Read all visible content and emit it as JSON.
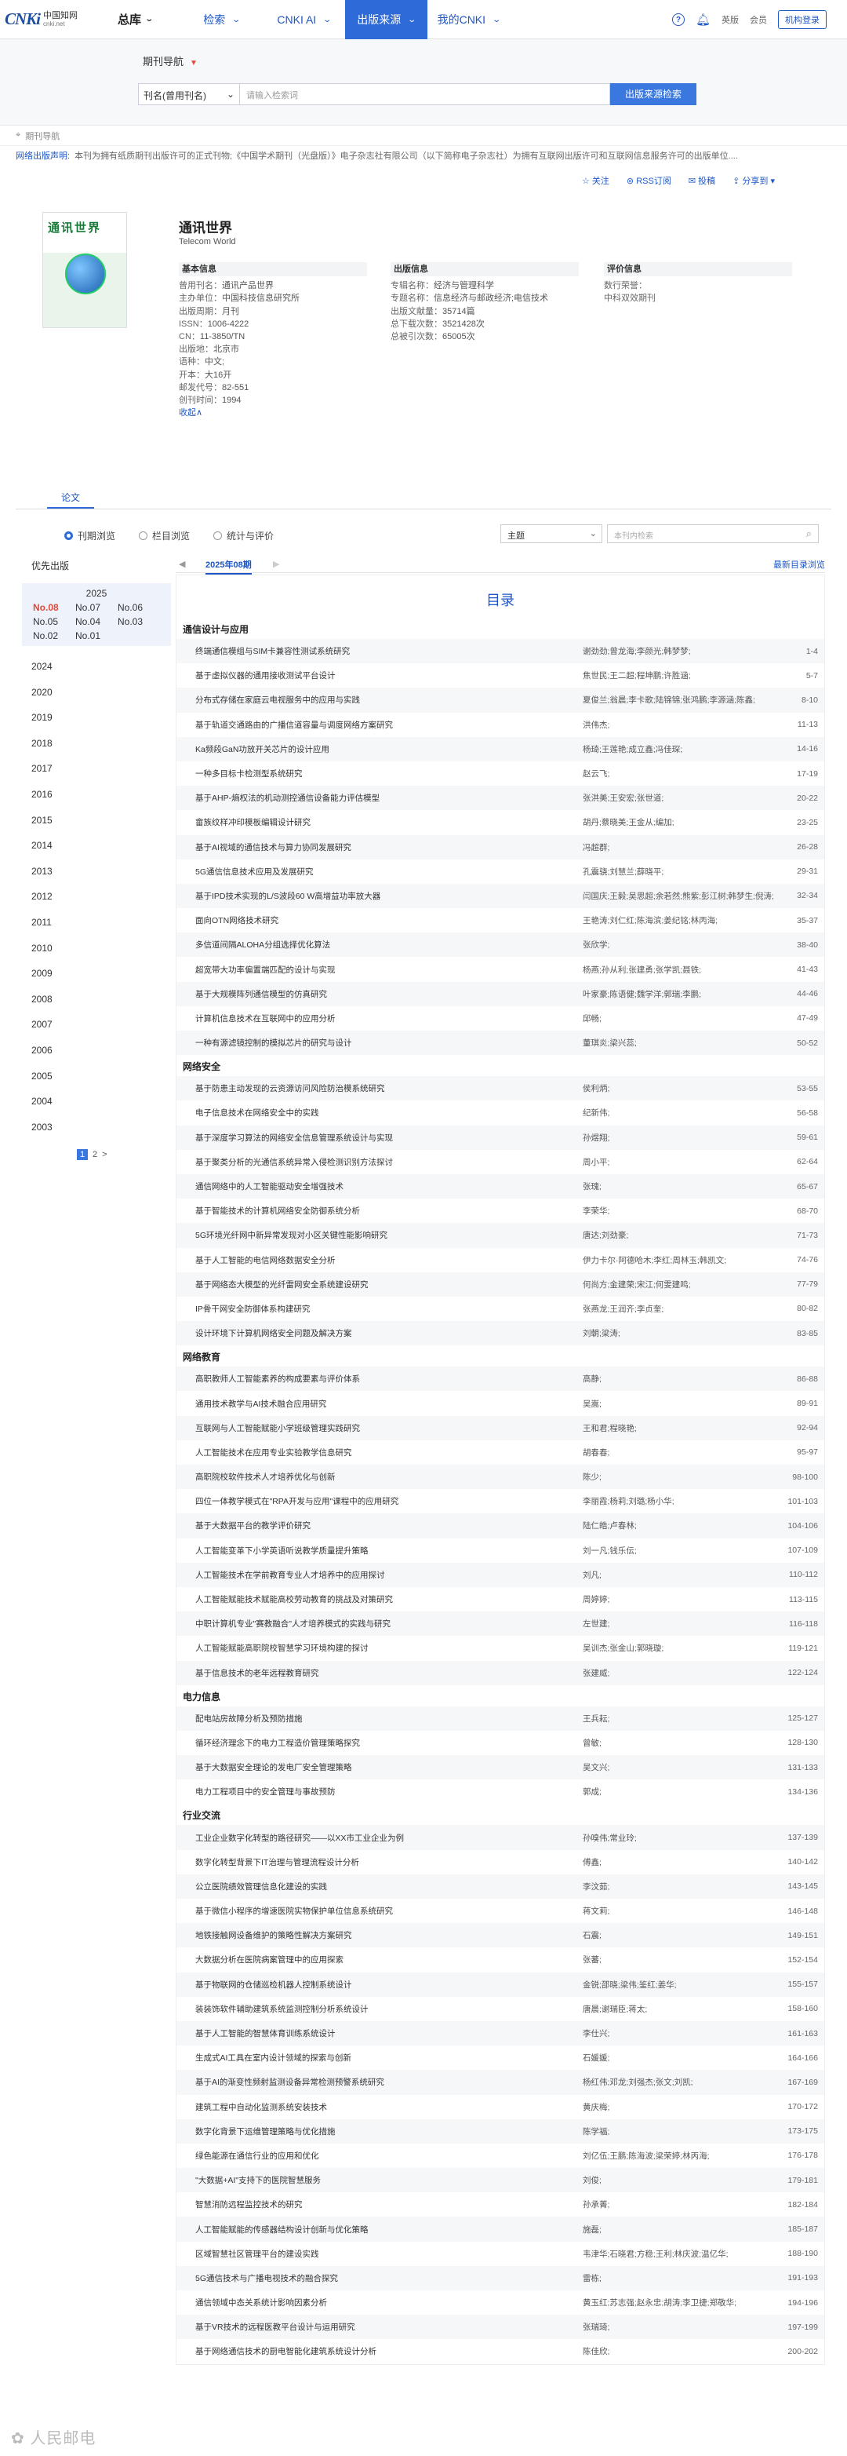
{
  "header": {
    "logo_mark": "CNKi",
    "logo_cn": "中国知网",
    "logo_sub": "cnki.net",
    "zongku": "总库",
    "nav": [
      {
        "label": "检索",
        "active": false
      },
      {
        "label": "CNKI AI",
        "active": false
      },
      {
        "label": "出版来源",
        "active": true
      },
      {
        "label": "我的CNKI",
        "active": false
      }
    ],
    "help": "?",
    "links": [
      "英版",
      "会员"
    ],
    "login": "机构登录"
  },
  "search": {
    "title": "期刊导航",
    "field": "刊名(曾用刊名)",
    "placeholder": "请输入检索词",
    "button": "出版来源检索"
  },
  "breadcrumb": "期刊导航",
  "notice": {
    "label": "网络出版声明:",
    "text": "本刊为拥有纸质期刊出版许可的正式刊物;《中国学术期刊（光盘版）》电子杂志社有限公司（以下简称电子杂志社）为拥有互联网出版许可和互联网信息服务许可的出版单位...."
  },
  "actions": [
    "关注",
    "RSS订阅",
    "投稿",
    "分享到"
  ],
  "journal": {
    "cover_title": "通讯世界",
    "name": "通讯世界",
    "en_name": "Telecom World",
    "basic_title": "基本信息",
    "basic": [
      [
        "曾用刊名：",
        "通讯产品世界"
      ],
      [
        "主办单位：",
        "中国科技信息研究所"
      ],
      [
        "出版周期：",
        "月刊"
      ],
      [
        "ISSN：",
        "1006-4222"
      ],
      [
        "CN：",
        "11-3850/TN"
      ],
      [
        "出版地：",
        "北京市"
      ],
      [
        "语种：",
        "中文;"
      ],
      [
        "开本：",
        "大16开"
      ],
      [
        "邮发代号：",
        "82-551"
      ],
      [
        "创刊时间：",
        "1994"
      ]
    ],
    "more": "收起∧",
    "pub_title": "出版信息",
    "pub": [
      [
        "专辑名称：",
        "经济与管理科学"
      ],
      [
        "专题名称：",
        "信息经济与邮政经济;电信技术"
      ],
      [
        "出版文献量：",
        "35714篇"
      ],
      [
        "总下载次数：",
        "3521428次"
      ],
      [
        "总被引次数：",
        "65005次"
      ]
    ],
    "eval_title": "评价信息",
    "eval": [
      [
        "数行荣誉：",
        ""
      ],
      [
        "中科双效期刊",
        ""
      ]
    ]
  },
  "tabs": [
    "论文"
  ],
  "radios": [
    {
      "label": "刊期浏览",
      "on": true
    },
    {
      "label": "栏目浏览",
      "on": false
    },
    {
      "label": "统计与评价",
      "on": false
    }
  ],
  "filter": {
    "subject": "主题",
    "search_placeholder": "本刊内检索"
  },
  "left": {
    "first": "优先出版",
    "cur_year": "2025",
    "issues": [
      "No.08",
      "No.07",
      "No.06",
      "No.05",
      "No.04",
      "No.03",
      "No.02",
      "No.01"
    ],
    "years": [
      "2024",
      "2020",
      "2019",
      "2018",
      "2017",
      "2016",
      "2015",
      "2014",
      "2013",
      "2012",
      "2011",
      "2010",
      "2009",
      "2008",
      "2007",
      "2006",
      "2005",
      "2004",
      "2003"
    ],
    "pages": [
      "1",
      "2",
      ">"
    ]
  },
  "issuebar": {
    "prev": "◀",
    "cur": "2025年08期",
    "next": "▶",
    "toclink": "最新目录浏览"
  },
  "toc": {
    "title": "目录",
    "sections": [
      {
        "name": "通信设计与应用",
        "items": [
          [
            "终端通信模组与SIM卡兼容性测试系统研究",
            "谢劲劲;曾龙海;李颜光;韩梦梦;",
            "1-4"
          ],
          [
            "基于虚拟仪器的通用接收测试平台设计",
            "焦世民;王二超;程坤鹏;许胜涵;",
            "5-7"
          ],
          [
            "分布式存储在家庭云电视服务中的应用与实践",
            "夏俊兰;翁晨;李卡歌;陆锦锦;张鸿鹏;李源涵;陈鑫;",
            "8-10"
          ],
          [
            "基于轨道交通路由的广播信道容量与调度网络方案研究",
            "洪伟杰;",
            "11-13"
          ],
          [
            "Ka频段GaN功放开关芯片的设计应用",
            "杨琦;王莲艳;成立鑫;冯佳琛;",
            "14-16"
          ],
          [
            "一种多目标卡检测型系统研究",
            "赵云飞;",
            "17-19"
          ],
          [
            "基于AHP-熵权法的机动测控通信设备能力评估模型",
            "张洪美;王安宏;张世道;",
            "20-22"
          ],
          [
            "畲族纹样冲印模板编辑设计研究",
            "胡丹;蔡晓美;王金从;编加;",
            "23-25"
          ],
          [
            "基于AI视域的通信技术与算力协同发展研究",
            "冯超群;",
            "26-28"
          ],
          [
            "5G通信信息技术应用及发展研究",
            "孔震骁;刘慧兰;薛晓平;",
            "29-31"
          ],
          [
            "基于IPD技术实现的L/S波段60 W高增益功率放大器",
            "闫国庆;王毅;吴思超;余若然;熊紫;彭江树;韩梦生;倪涛;",
            "32-34"
          ],
          [
            "面向OTN网络技术研究",
            "王艳涛;刘仁红;陈海滨;姜纪铭;林丙海;",
            "35-37"
          ],
          [
            "多信道间隔ALOHA分组选择优化算法",
            "张欣学;",
            "38-40"
          ],
          [
            "超宽带大功率偏置端匹配的设计与实现",
            "杨燕;孙从利;张建勇;张学凯;聂铁;",
            "41-43"
          ],
          [
            "基于大规模阵列通信模型的仿真研究",
            "叶家豪;陈语健;魏学洋;郭瑞;李鹏;",
            "44-46"
          ],
          [
            "计算机信息技术在互联网中的应用分析",
            "邱畅;",
            "47-49"
          ],
          [
            "一种有源滤镜控制的模拟芯片的研究与设计",
            "董琪炎;梁兴蕊;",
            "50-52"
          ]
        ]
      },
      {
        "name": "网络安全",
        "items": [
          [
            "基于防患主动发现的云资源访问风险防治模系统研究",
            "侯利炳;",
            "53-55"
          ],
          [
            "电子信息技术在网络安全中的实践",
            "纪新伟;",
            "56-58"
          ],
          [
            "基于深度学习算法的网络安全信息管理系统设计与实现",
            "孙煜翔;",
            "59-61"
          ],
          [
            "基于聚类分析的光通信系统异常入侵检测识别方法探讨",
            "周小平;",
            "62-64"
          ],
          [
            "通信网络中的人工智能驱动安全增强技术",
            "张瑰;",
            "65-67"
          ],
          [
            "基于智能技术的计算机网络安全防御系统分析",
            "李荣华;",
            "68-70"
          ],
          [
            "5G环境光纤网中新异常发现对小区关键性能影响研究",
            "唐达;刘劲豪;",
            "71-73"
          ],
          [
            "基于人工智能的电信网络数据安全分析",
            "伊力卡尔·阿德哈木;李红;周林玉;韩凯文;",
            "74-76"
          ],
          [
            "基于网络态大模型的光纤雷网安全系统建设研究",
            "何尚方;金建荣;宋江;何雯建鸣;",
            "77-79"
          ],
          [
            "IP骨干网安全防御体系构建研究",
            "张燕龙;王润齐;李贞奎;",
            "80-82"
          ],
          [
            "设计环境下计算机网络安全问题及解决方案",
            "刘朝;梁涛;",
            "83-85"
          ]
        ]
      },
      {
        "name": "网络教育",
        "items": [
          [
            "高职教师人工智能素养的构成要素与评价体系",
            "高静;",
            "86-88"
          ],
          [
            "通用技术教学与AI技术融合应用研究",
            "吴嵩;",
            "89-91"
          ],
          [
            "互联网与人工智能赋能小学班级管理实践研究",
            "王和君;程晓艳;",
            "92-94"
          ],
          [
            "人工智能技术在应用专业实验教学信息研究",
            "胡春春;",
            "95-97"
          ],
          [
            "高职院校软件技术人才培养优化与创新",
            "陈少;",
            "98-100"
          ],
          [
            "四位一体教学模式在\"RPA开发与应用\"课程中的应用研究",
            "李丽霞;杨莉;刘璐;杨小华;",
            "101-103"
          ],
          [
            "基于大数据平台的教学评价研究",
            "陆仁皓;卢春林;",
            "104-106"
          ],
          [
            "人工智能变革下小学英语听说教学质量提升策略",
            "刘一凡;钱乐伝;",
            "107-109"
          ],
          [
            "人工智能技术在学前教育专业人才培养中的应用探讨",
            "刘凡;",
            "110-112"
          ],
          [
            "人工智能赋能技术赋能高校劳动教育的挑战及对策研究",
            "周婷婷;",
            "113-115"
          ],
          [
            "中职计算机专业\"赛教融合\"人才培养模式的实践与研究",
            "左世建;",
            "116-118"
          ],
          [
            "人工智能赋能高职院校智慧学习环境构建的探讨",
            "吴训杰;张金山;郭晓璇;",
            "119-121"
          ],
          [
            "基于信息技术的老年远程教育研究",
            "张建威;",
            "122-124"
          ]
        ]
      },
      {
        "name": "电力信息",
        "items": [
          [
            "配电站房故障分析及预防措施",
            "王兵耘;",
            "125-127"
          ],
          [
            "循环经济理念下的电力工程造价管理策略探究",
            "曾敏;",
            "128-130"
          ],
          [
            "基于大数据安全理论的发电厂安全管理策略",
            "吴文兴;",
            "131-133"
          ],
          [
            "电力工程项目中的安全管理与事故预防",
            "郭成;",
            "134-136"
          ]
        ]
      },
      {
        "name": "行业交流",
        "items": [
          [
            "工业企业数字化转型的路径研究——以XX市工业企业为例",
            "孙嗅伟;常业玲;",
            "137-139"
          ],
          [
            "数字化转型背景下IT治理与管理流程设计分析",
            "傅鑫;",
            "140-142"
          ],
          [
            "公立医院绩效管理信息化建设的实践",
            "李汶茹;",
            "143-145"
          ],
          [
            "基于微信小程序的增速医院实物保护单位信息系统研究",
            "蒋文莉;",
            "146-148"
          ],
          [
            "地铁接触网设备维护的策略性解决方案研究",
            "石震;",
            "149-151"
          ],
          [
            "大数据分析在医院病案管理中的应用探索",
            "张蕃;",
            "152-154"
          ],
          [
            "基于物联网的仓储巡检机器人控制系统设计",
            "金锐;邵晓;梁伟;鉴红;姜华;",
            "155-157"
          ],
          [
            "装装饰软件辅助建筑系统监测控制分析系统设计",
            "唐晨;谢瑞臣;蒋太;",
            "158-160"
          ],
          [
            "基于人工智能的智慧体育训练系统设计",
            "李仕兴;",
            "161-163"
          ],
          [
            "生成式AI工具在室内设计领域的探索与创新",
            "石媛媛;",
            "164-166"
          ],
          [
            "基于AI的渐变性频射监测设备异常检测预警系统研究",
            "杨红伟;邓龙;刘强杰;张文;刘凯;",
            "167-169"
          ],
          [
            "建筑工程中自动化监测系统安装技术",
            "黄庆梅;",
            "170-172"
          ],
          [
            "数字化背景下运维管理策略与优化措施",
            "陈学福;",
            "173-175"
          ],
          [
            "绿色能源在通信行业的应用和优化",
            "刘亿伍;王鹏;陈海波;梁荣婷;林丙海;",
            "176-178"
          ],
          [
            "\"大数据+AI\"支持下的医院智慧服务",
            "刘俊;",
            "179-181"
          ],
          [
            "智慧消防远程监控技术的研究",
            "孙承菁;",
            "182-184"
          ],
          [
            "人工智能赋能的传感器结构设计创新与优化策略",
            "施磊;",
            "185-187"
          ],
          [
            "区域智慧社区管理平台的建设实践",
            "韦津华;石晓君;方稳;王利;林庆波;温亿华;",
            "188-190"
          ],
          [
            "5G通信技术与广播电视技术的融合探究",
            "雷栋;",
            "191-193"
          ],
          [
            "通信领域中态关系统计影响因素分析",
            "黄玉红;苏志强;赵永忠;胡涛;李卫捷;郑敬华;",
            "194-196"
          ],
          [
            "基于VR技术的远程医教平台设计与运用研究",
            "张瑞琦;",
            "197-199"
          ],
          [
            "基于网络通信技术的厨电智能化建筑系统设计分析",
            "陈佳欣;",
            "200-202"
          ]
        ]
      }
    ]
  },
  "watermark": "✿ 人民邮电"
}
